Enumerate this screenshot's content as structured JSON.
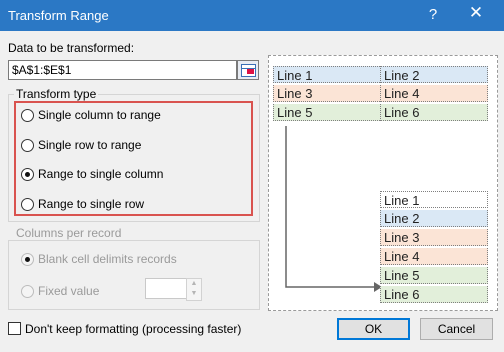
{
  "window": {
    "title": "Transform Range",
    "help_icon": "?",
    "close_icon": "✕"
  },
  "data_label": "Data to be transformed:",
  "range_value": "$A$1:$E$1",
  "transform_type": {
    "legend": "Transform type",
    "options": [
      {
        "label": "Single column to range",
        "checked": false
      },
      {
        "label": "Single row to range",
        "checked": false
      },
      {
        "label": "Range to single column",
        "checked": true
      },
      {
        "label": "Range to single row",
        "checked": false
      }
    ]
  },
  "columns_per_record": {
    "legend": "Columns per record",
    "blank_cell_label": "Blank cell delimits records",
    "fixed_value_label": "Fixed value",
    "fixed_value": ""
  },
  "dont_keep_formatting_label": "Don't keep formatting (processing faster)",
  "buttons": {
    "ok": "OK",
    "cancel": "Cancel"
  },
  "preview": {
    "source": [
      [
        "Line 1",
        "Line 2"
      ],
      [
        "Line 3",
        "Line 4"
      ],
      [
        "Line 5",
        "Line 6"
      ]
    ],
    "result": [
      "Line 1",
      "Line 2",
      "Line 3",
      "Line 4",
      "Line 5",
      "Line 6"
    ]
  }
}
